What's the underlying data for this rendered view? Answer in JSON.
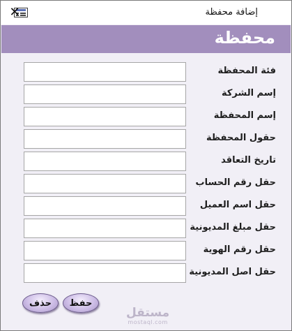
{
  "window": {
    "title": "إضافة محفظة",
    "close_glyph": "✕"
  },
  "header": {
    "title": "محفظة"
  },
  "fields": [
    {
      "label": "فئة المحفظة",
      "value": ""
    },
    {
      "label": "إسم الشركة",
      "value": ""
    },
    {
      "label": "إسم المحفظة",
      "value": ""
    },
    {
      "label": "حقول المحفظة",
      "value": ""
    },
    {
      "label": "تاريخ التعاقد",
      "value": ""
    },
    {
      "label": "حقل رقم الحساب",
      "value": ""
    },
    {
      "label": "حقل اسم  العميل",
      "value": ""
    },
    {
      "label": "حقل مبلغ المديونية",
      "value": ""
    },
    {
      "label": "حقل رقم الهوية",
      "value": ""
    },
    {
      "label": "حقل اصل المديونية",
      "value": ""
    }
  ],
  "buttons": {
    "save_label": "حفظ",
    "delete_label": "حذف"
  },
  "watermark": {
    "main": "مستقل",
    "sub": "mostaql.com"
  },
  "colors": {
    "header": "#a28ebd",
    "form_background": "#f1eff6",
    "button": "#cdbde6"
  },
  "icons": {
    "app": "form-icon",
    "close": "close-icon"
  }
}
